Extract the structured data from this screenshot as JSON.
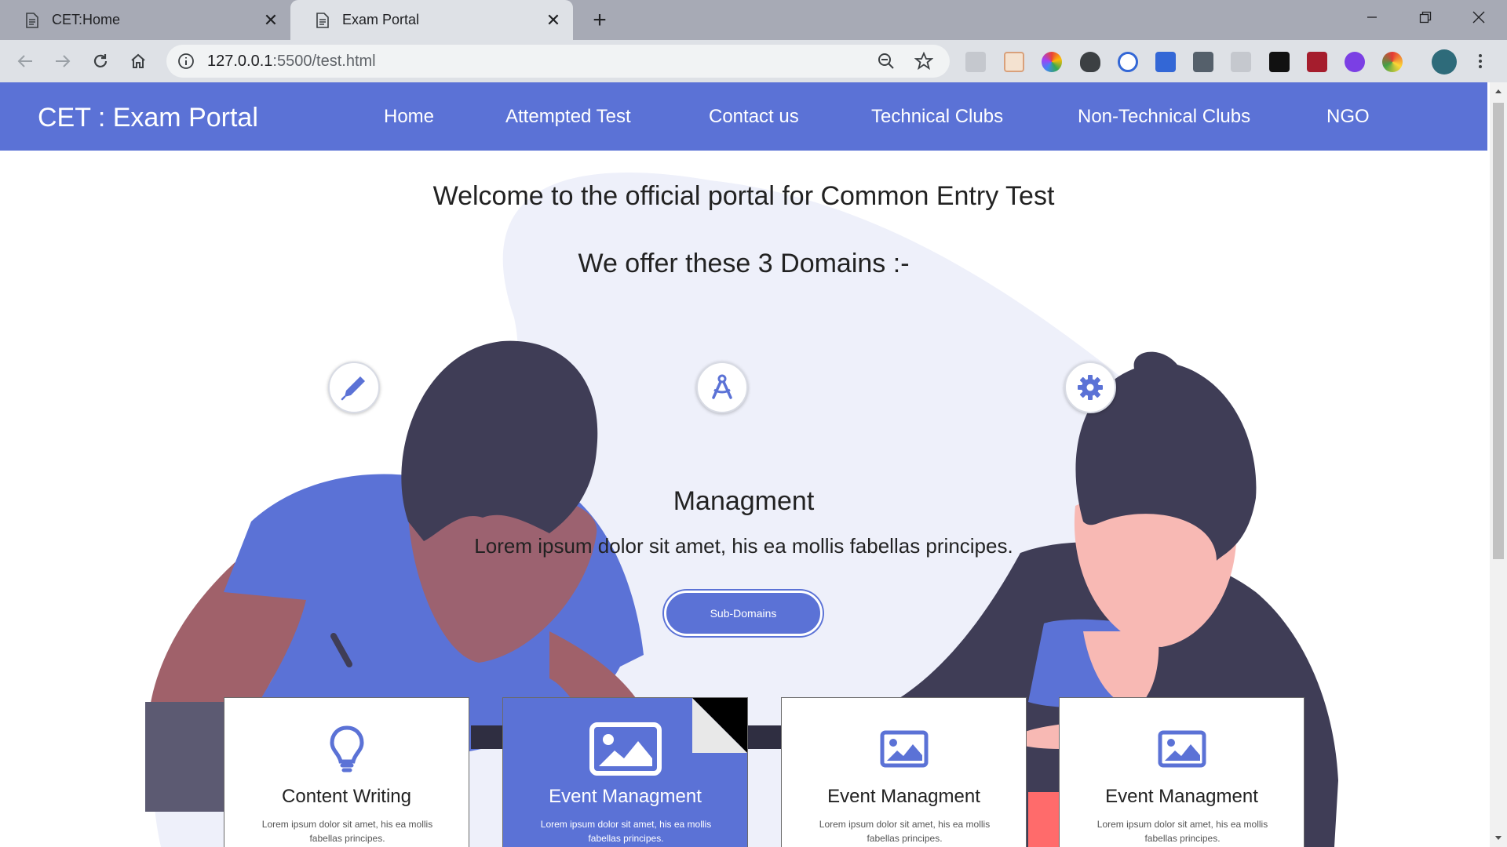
{
  "browser": {
    "tabs": [
      {
        "title": "CET:Home",
        "active": false
      },
      {
        "title": "Exam Portal",
        "active": true
      }
    ],
    "url_host": "127.0.0.1",
    "url_rest": ":5500/test.html"
  },
  "navbar": {
    "brand": "CET : Exam Portal",
    "items": [
      "Home",
      "Attempted Test",
      "Contact us",
      "Technical Clubs",
      "Non-Technical Clubs",
      "NGO"
    ]
  },
  "hero": {
    "welcome": "Welcome to the official portal for Common Entry Test",
    "domains_title": "We offer these 3 Domains :-",
    "domain_icons": [
      "pen-icon",
      "compass-icon",
      "gear-icon"
    ],
    "selected_domain": {
      "heading": "Managment",
      "description": "Lorem ipsum dolor sit amet, his ea mollis fabellas principes.",
      "button_label": "Sub-Domains"
    }
  },
  "cards": [
    {
      "title": "Content Writing",
      "description": "Lorem ipsum dolor sit amet, his ea mollis fabellas principes.",
      "icon": "lightbulb-icon",
      "active": false
    },
    {
      "title": "Event Managment",
      "description": "Lorem ipsum dolor sit amet, his ea mollis fabellas principes.",
      "icon": "image-icon",
      "active": true
    },
    {
      "title": "Event Managment",
      "description": "Lorem ipsum dolor sit amet, his ea mollis fabellas principes.",
      "icon": "image-icon",
      "active": false
    },
    {
      "title": "Event Managment",
      "description": "Lorem ipsum dolor sit amet, his ea mollis fabellas principes.",
      "icon": "image-icon",
      "active": false
    }
  ],
  "colors": {
    "primary": "#5b72d6",
    "hair": "#3f3d56",
    "skin_dark": "#a0616a",
    "skin_light": "#f8b9b4",
    "blob": "#eef0fa"
  }
}
